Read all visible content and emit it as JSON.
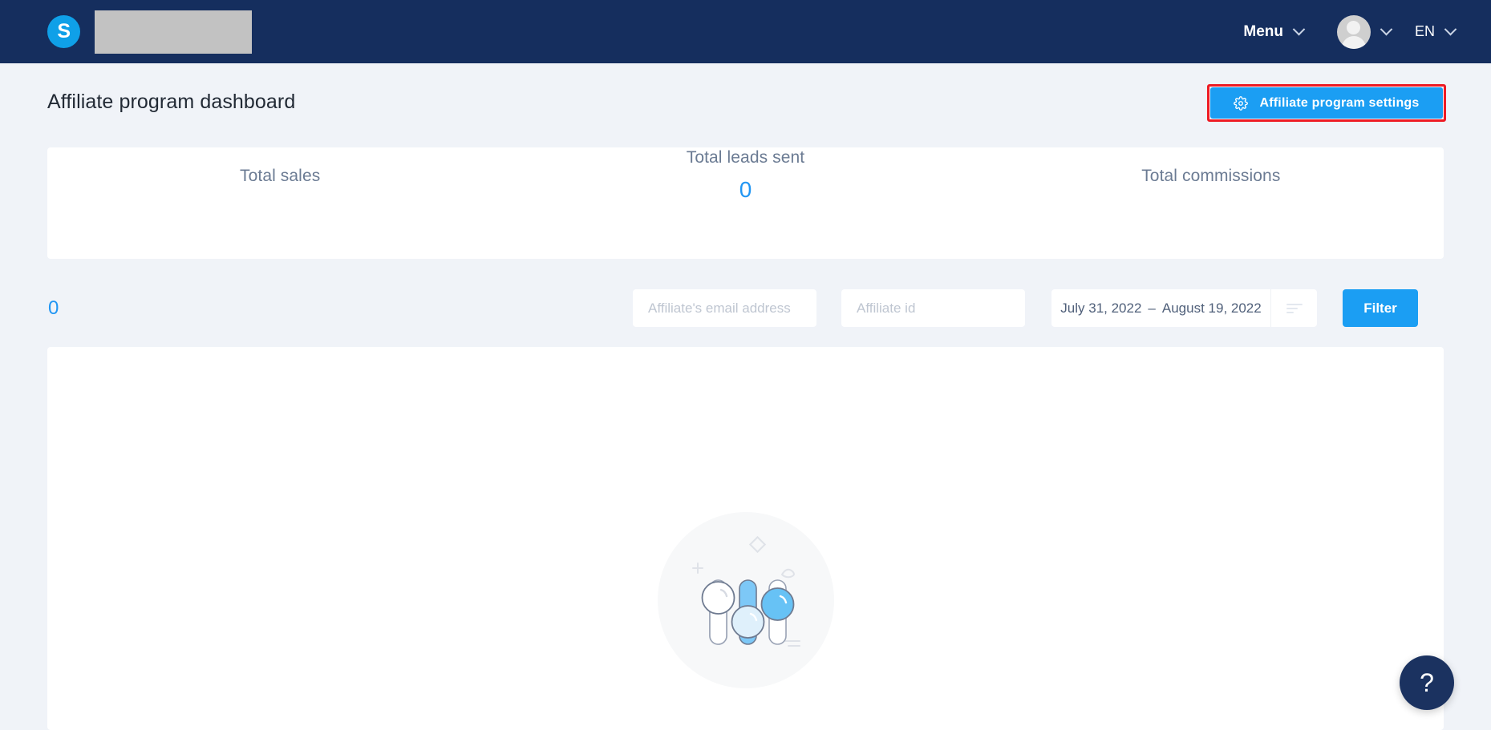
{
  "topbar": {
    "logo_letter": "S",
    "logo_icon": "app-logo-icon",
    "brand_redacted": "",
    "menu_label": "Menu",
    "menu_chevron_icon": "chevron-down-icon",
    "avatar_icon": "user-avatar-icon",
    "avatar_chevron_icon": "chevron-down-icon",
    "language_label": "EN",
    "language_chevron_icon": "chevron-down-icon",
    "bg_color": "#152e5e",
    "logo_color": "#0fa0e8"
  },
  "page": {
    "title": "Affiliate program dashboard",
    "background_color": "#f0f3f8"
  },
  "settings_button": {
    "label": "Affiliate program settings",
    "icon": "gear-icon",
    "color": "#1b9ef3",
    "highlight_color": "#ee1b24"
  },
  "stats": [
    {
      "label": "Total sales",
      "value": ""
    },
    {
      "label": "Total leads sent",
      "value": "0"
    },
    {
      "label": "Total commissions",
      "value": ""
    }
  ],
  "filters": {
    "result_count": "0",
    "email_placeholder": "Affiliate's email address",
    "email_value": "",
    "affiliate_id_placeholder": "Affiliate id",
    "affiliate_id_value": "",
    "date_from": "July 31, 2022",
    "date_separator": "–",
    "date_to": "August 19, 2022",
    "date_icon": "filter-lines-icon",
    "filter_button_label": "Filter"
  },
  "content": {
    "empty_illustration_icon": "sliders-empty-state-icon"
  },
  "help": {
    "label": "?",
    "icon": "help-question-icon",
    "color": "#1b3260"
  },
  "accent_color": "#2196f3"
}
